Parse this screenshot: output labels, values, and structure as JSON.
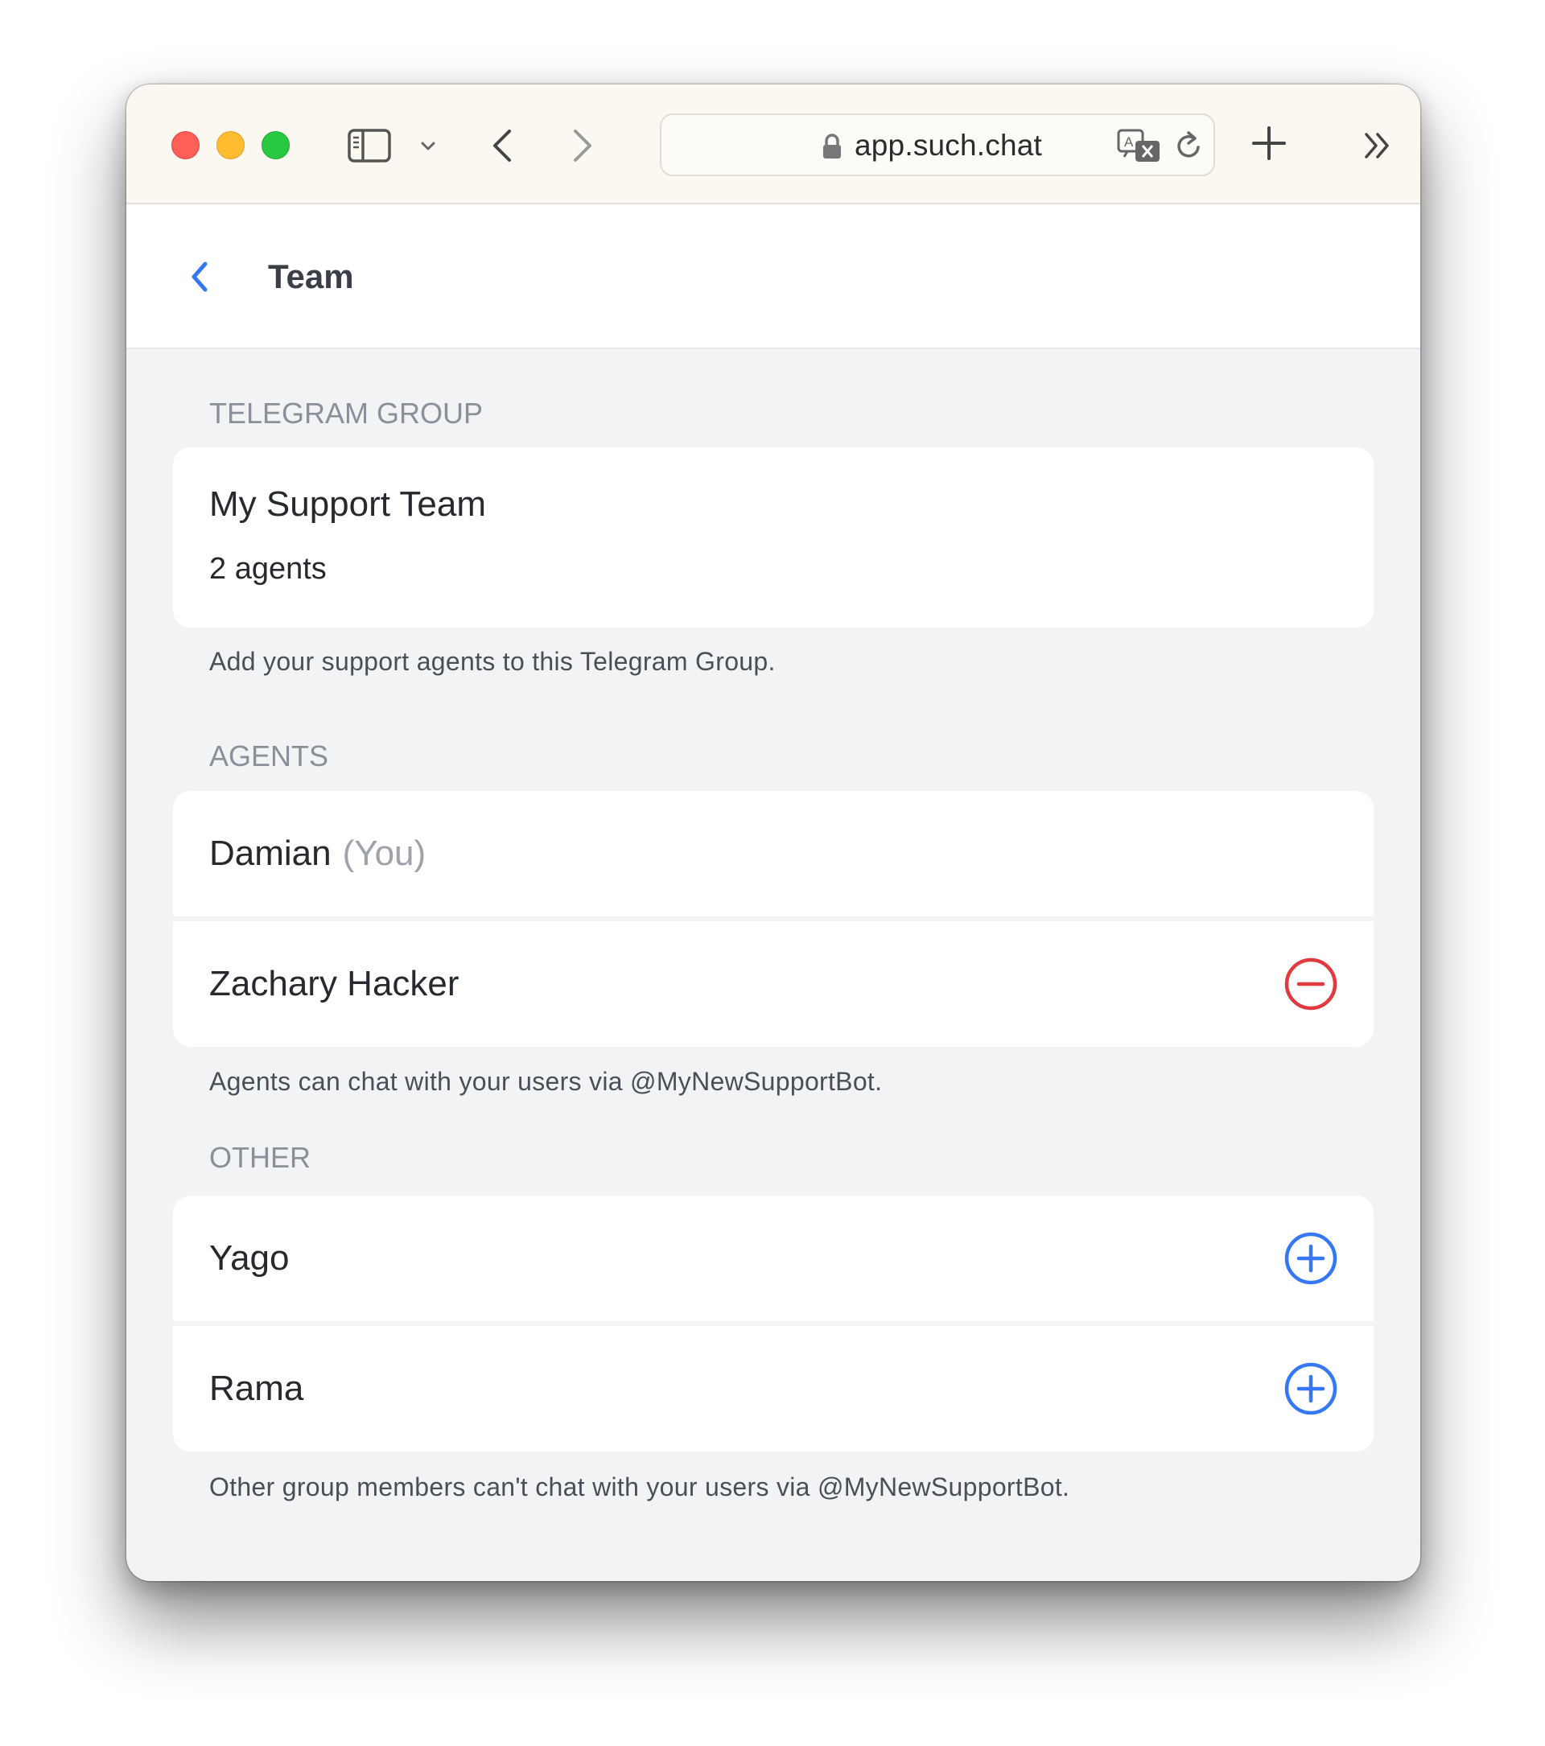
{
  "browser": {
    "url": "app.such.chat"
  },
  "header": {
    "title": "Team"
  },
  "telegram_group": {
    "section_label": "TELEGRAM GROUP",
    "name": "My Support Team",
    "count": "2 agents",
    "note": "Add your support agents to this Telegram Group."
  },
  "agents": {
    "section_label": "AGENTS",
    "items": [
      {
        "name": "Damian",
        "suffix": "(You)"
      },
      {
        "name": "Zachary Hacker"
      }
    ],
    "note": "Agents can chat with your users via @MyNewSupportBot."
  },
  "other": {
    "section_label": "OTHER",
    "items": [
      {
        "name": "Yago"
      },
      {
        "name": "Rama"
      }
    ],
    "note": "Other group members can't chat with your users via @MyNewSupportBot."
  },
  "colors": {
    "accent": "#3478f6",
    "destructive": "#e0393e",
    "background": "#f2f3f5"
  },
  "icons": {
    "back": "chevron-left-icon",
    "remove": "minus-circle-icon",
    "add": "plus-circle-icon"
  }
}
